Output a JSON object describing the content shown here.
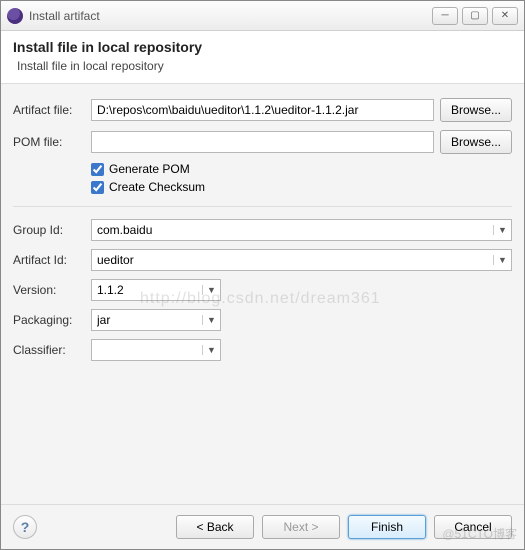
{
  "window": {
    "title": "Install artifact"
  },
  "header": {
    "title": "Install file in local repository",
    "description": "Install file in local repository"
  },
  "fields": {
    "artifact_file": {
      "label": "Artifact file:",
      "value": "D:\\repos\\com\\baidu\\ueditor\\1.1.2\\ueditor-1.1.2.jar"
    },
    "pom_file": {
      "label": "POM file:",
      "value": ""
    },
    "generate_pom": {
      "label": "Generate POM",
      "checked": true
    },
    "create_checksum": {
      "label": "Create Checksum",
      "checked": true
    },
    "group_id": {
      "label": "Group Id:",
      "value": "com.baidu"
    },
    "artifact_id": {
      "label": "Artifact Id:",
      "value": "ueditor"
    },
    "version": {
      "label": "Version:",
      "value": "1.1.2"
    },
    "packaging": {
      "label": "Packaging:",
      "value": "jar"
    },
    "classifier": {
      "label": "Classifier:",
      "value": ""
    }
  },
  "buttons": {
    "browse": "Browse...",
    "back": "< Back",
    "next": "Next >",
    "finish": "Finish",
    "cancel": "Cancel"
  },
  "watermark": "http://blog.csdn.net/dream361",
  "corner_mark": "@51CTO博客"
}
